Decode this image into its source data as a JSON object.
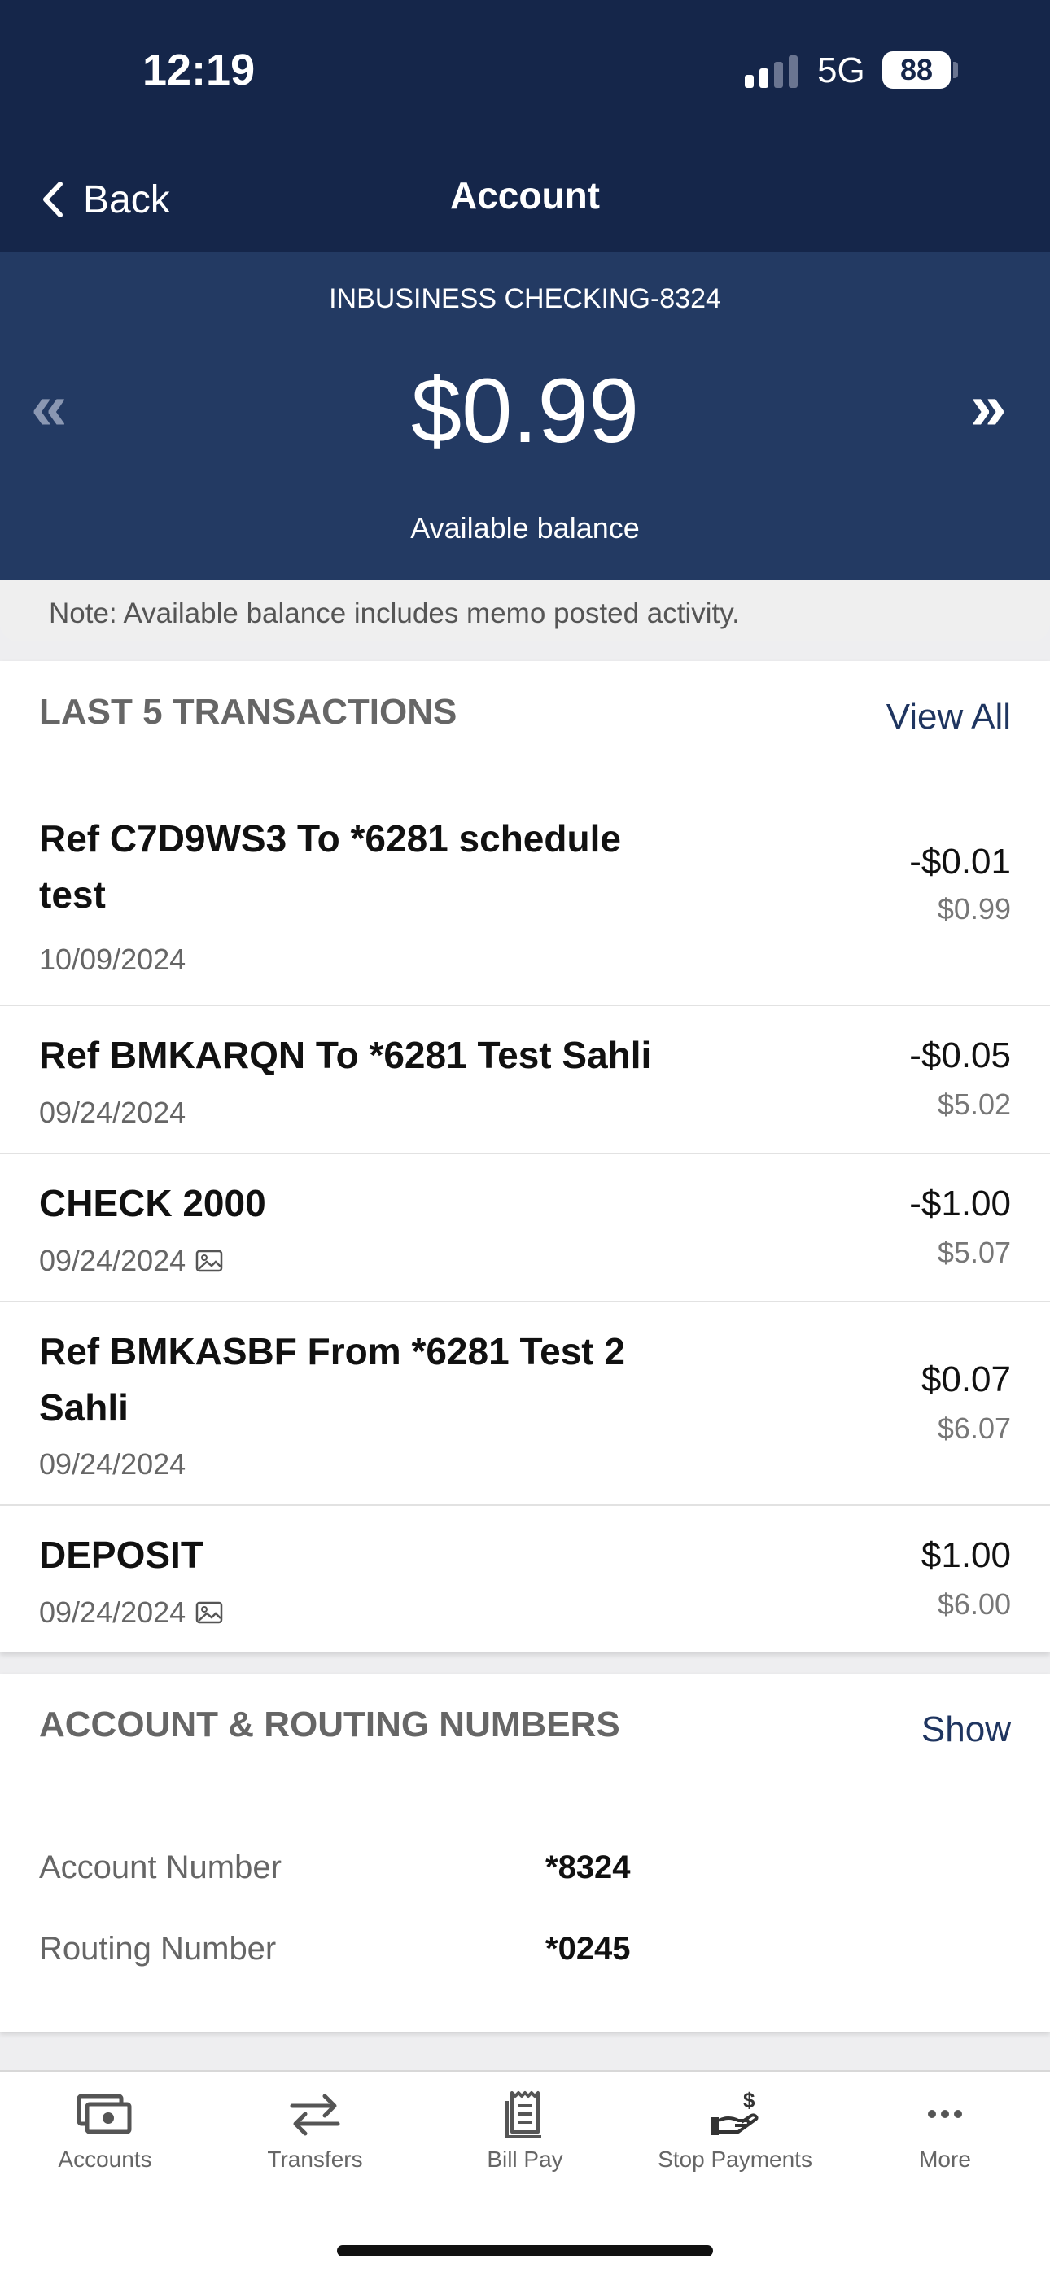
{
  "status_bar": {
    "time": "12:19",
    "network": "5G",
    "battery": "88"
  },
  "nav": {
    "back_label": "Back",
    "title": "Account"
  },
  "account": {
    "name": "INBUSINESS CHECKING-8324",
    "balance": "$0.99",
    "balance_label": "Available balance",
    "prev_arrow": "«",
    "next_arrow": "»"
  },
  "note": "Note: Available balance includes memo posted activity.",
  "transactions_section": {
    "title": "LAST 5 TRANSACTIONS",
    "view_all": "View All",
    "items": [
      {
        "description": "Ref C7D9WS3 To *6281 schedule test",
        "date": "10/09/2024",
        "amount": "-$0.01",
        "running_balance": "$0.99",
        "has_image": false
      },
      {
        "description": "Ref BMKARQN To *6281 Test Sahli",
        "date": "09/24/2024",
        "amount": "-$0.05",
        "running_balance": "$5.02",
        "has_image": false
      },
      {
        "description": "CHECK 2000",
        "date": "09/24/2024",
        "amount": "-$1.00",
        "running_balance": "$5.07",
        "has_image": true
      },
      {
        "description": "Ref BMKASBF From *6281 Test 2 Sahli",
        "date": "09/24/2024",
        "amount": "$0.07",
        "running_balance": "$6.07",
        "has_image": false
      },
      {
        "description": "DEPOSIT",
        "date": "09/24/2024",
        "amount": "$1.00",
        "running_balance": "$6.00",
        "has_image": true
      }
    ]
  },
  "routing_section": {
    "title": "ACCOUNT & ROUTING NUMBERS",
    "show_label": "Show",
    "account_number_label": "Account Number",
    "account_number": "*8324",
    "routing_number_label": "Routing Number",
    "routing_number": "*0245"
  },
  "tab_bar": {
    "items": [
      {
        "label": "Accounts",
        "icon": "accounts-icon"
      },
      {
        "label": "Transfers",
        "icon": "transfers-icon"
      },
      {
        "label": "Bill Pay",
        "icon": "bill-pay-icon"
      },
      {
        "label": "Stop Payments",
        "icon": "stop-payments-icon"
      },
      {
        "label": "More",
        "icon": "more-icon"
      }
    ]
  },
  "colors": {
    "header_bg": "#15264a",
    "account_bg": "#233a63",
    "link": "#1f3560"
  }
}
